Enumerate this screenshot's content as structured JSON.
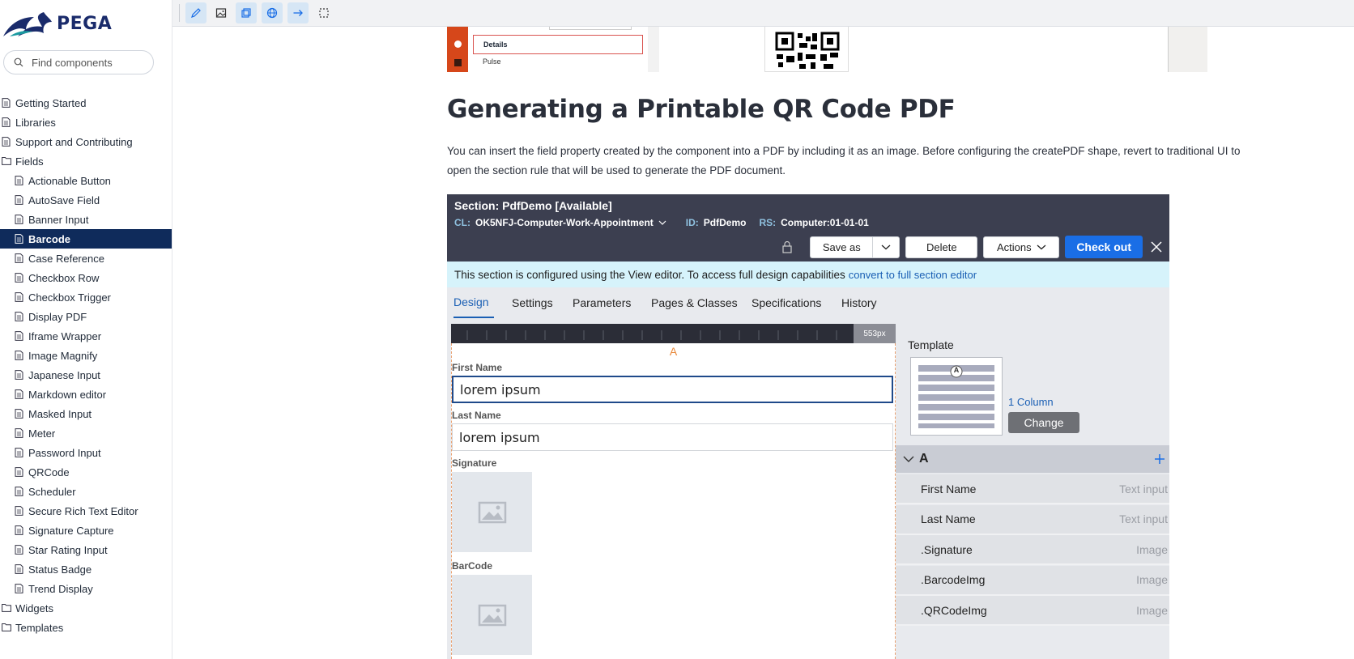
{
  "brand": {
    "logo_text": "PEGA"
  },
  "search": {
    "placeholder": "Find components"
  },
  "sidebar": {
    "items": [
      {
        "label": "Getting Started",
        "type": "page",
        "level": 0
      },
      {
        "label": "Libraries",
        "type": "page",
        "level": 0
      },
      {
        "label": "Support and Contributing",
        "type": "page",
        "level": 0
      },
      {
        "label": "Fields",
        "type": "folder",
        "level": 0
      },
      {
        "label": "Actionable Button",
        "type": "page",
        "level": 1
      },
      {
        "label": "AutoSave Field",
        "type": "page",
        "level": 1
      },
      {
        "label": "Banner Input",
        "type": "page",
        "level": 1
      },
      {
        "label": "Barcode",
        "type": "page",
        "level": 1,
        "active": true
      },
      {
        "label": "Case Reference",
        "type": "page",
        "level": 1
      },
      {
        "label": "Checkbox Row",
        "type": "page",
        "level": 1
      },
      {
        "label": "Checkbox Trigger",
        "type": "page",
        "level": 1
      },
      {
        "label": "Display PDF",
        "type": "page",
        "level": 1
      },
      {
        "label": "Iframe Wrapper",
        "type": "page",
        "level": 1
      },
      {
        "label": "Image Magnify",
        "type": "page",
        "level": 1
      },
      {
        "label": "Japanese Input",
        "type": "page",
        "level": 1
      },
      {
        "label": "Markdown editor",
        "type": "page",
        "level": 1
      },
      {
        "label": "Masked Input",
        "type": "page",
        "level": 1
      },
      {
        "label": "Meter",
        "type": "page",
        "level": 1
      },
      {
        "label": "Password Input",
        "type": "page",
        "level": 1
      },
      {
        "label": "QRCode",
        "type": "page",
        "level": 1
      },
      {
        "label": "Scheduler",
        "type": "page",
        "level": 1
      },
      {
        "label": "Secure Rich Text Editor",
        "type": "page",
        "level": 1
      },
      {
        "label": "Signature Capture",
        "type": "page",
        "level": 1
      },
      {
        "label": "Star Rating Input",
        "type": "page",
        "level": 1
      },
      {
        "label": "Status Badge",
        "type": "page",
        "level": 1
      },
      {
        "label": "Trend Display",
        "type": "page",
        "level": 1
      },
      {
        "label": "Widgets",
        "type": "folder",
        "level": 0
      },
      {
        "label": "Templates",
        "type": "folder",
        "level": 0
      }
    ]
  },
  "toolbar": {
    "icons": [
      "pencil-icon",
      "image-icon",
      "layers-icon",
      "globe-icon",
      "arrow-right-icon",
      "select-box-icon"
    ]
  },
  "top_image": {
    "menu_details": "Details",
    "menu_pulse": "Pulse"
  },
  "article": {
    "title": "Generating a Printable QR Code PDF",
    "description": "You can insert the field property created by the component into a PDF by including it as an image. Before configuring the createPDF shape, revert to traditional UI to open the section rule that will be used to generate the PDF document."
  },
  "screenshot": {
    "title": "Section: PdfDemo",
    "status": "[Available]",
    "cl_key": "CL:",
    "cl_value": "OK5NFJ-Computer-Work-Appointment",
    "id_key": "ID:",
    "id_value": "PdfDemo",
    "rs_key": "RS:",
    "rs_value": "Computer:01-01-01",
    "buttons": {
      "save_as": "Save as",
      "delete": "Delete",
      "actions": "Actions",
      "check_out": "Check out"
    },
    "banner_text": "This section is configured using the View editor. To access full design capabilities",
    "banner_link": "convert to full section editor",
    "tabs": [
      "Design",
      "Settings",
      "Parameters",
      "Pages & Classes",
      "Specifications",
      "History"
    ],
    "ruler_px": "553px",
    "region_label": "A",
    "fields": {
      "first_name_label": "First Name",
      "first_name_value": "lorem ipsum",
      "last_name_label": "Last Name",
      "last_name_value": "lorem ipsum",
      "signature_label": "Signature",
      "barcode_label": "BarCode"
    },
    "template": {
      "label": "Template",
      "thumb_letter": "A",
      "layout": "1 Column",
      "change": "Change"
    },
    "region": {
      "name": "A",
      "rows": [
        {
          "name": "First Name",
          "type": "Text input"
        },
        {
          "name": "Last Name",
          "type": "Text input"
        },
        {
          "name": ".Signature",
          "type": "Image"
        },
        {
          "name": ".BarcodeImg",
          "type": "Image"
        },
        {
          "name": ".QRCodeImg",
          "type": "Image"
        }
      ]
    }
  },
  "colors": {
    "brand_navy": "#0f2b5b",
    "brand_teal": "#1a9aa0",
    "accent_blue": "#1a6ee6",
    "header_dark": "#3c3f50",
    "banner_bg": "#d6f3fb"
  }
}
